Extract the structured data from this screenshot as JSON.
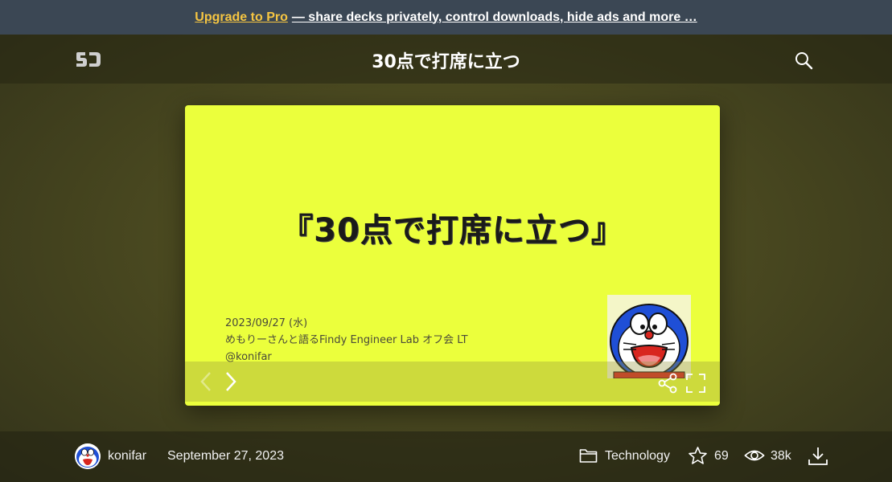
{
  "promo": {
    "upgrade_link": "Upgrade to Pro",
    "message": "— share decks privately, control downloads, hide ads and more …"
  },
  "header": {
    "logo_icon": "speakerdeck-logo-icon",
    "title": "30点で打席に立つ",
    "search_icon": "search-icon"
  },
  "slide": {
    "title": "『30点で打席に立つ』",
    "date_line": "2023/09/27 (水)",
    "event_line": "めもりーさんと語るFindy Engineer Lab オフ会 LT",
    "handle_line": "@konifar",
    "background_color": "#ebff3c",
    "controls": {
      "prev_icon": "chevron-left-icon",
      "next_icon": "chevron-right-icon",
      "share_icon": "share-icon",
      "fullscreen_icon": "fullscreen-icon"
    }
  },
  "footer": {
    "author_name": "konifar",
    "date": "September 27, 2023",
    "category": "Technology",
    "stars": "69",
    "views": "38k",
    "icons": [
      "folder-icon",
      "star-icon",
      "eye-icon",
      "download-icon"
    ]
  },
  "colors": {
    "promo_bg": "#3b4754",
    "upgrade_link": "#f5c542",
    "slide_bg": "#ebff3c"
  }
}
